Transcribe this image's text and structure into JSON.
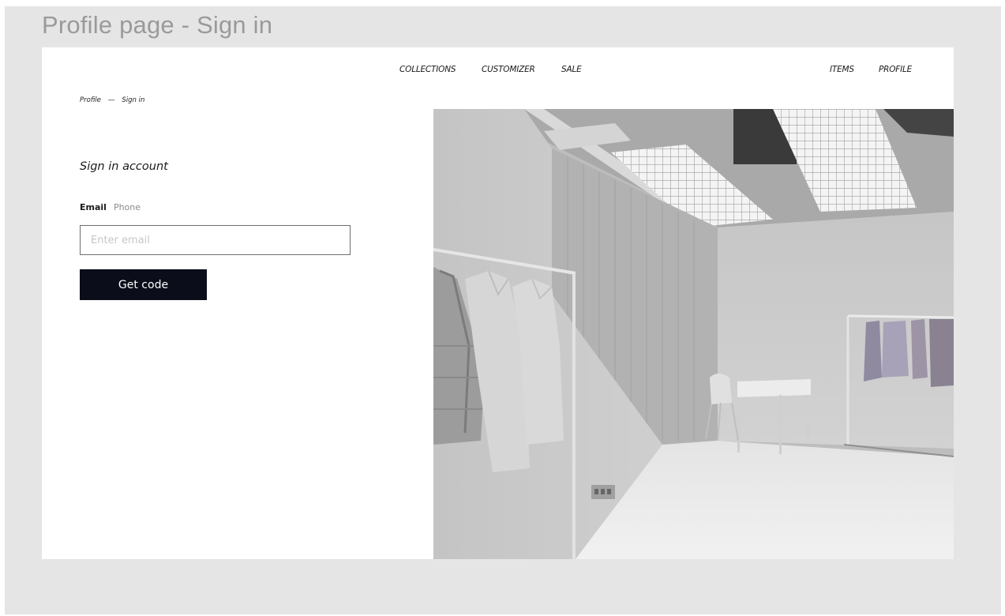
{
  "frame_title": "Profile page - Sign in",
  "nav": {
    "collections": "COLLECTIONS",
    "customizer": "CUSTOMIZER",
    "sale": "SALE",
    "items": "ITEMS",
    "profile": "PROFILE"
  },
  "breadcrumb": {
    "root": "Profile",
    "separator": "—",
    "current": "Sign in"
  },
  "form": {
    "heading": "Sign in account",
    "tabs": [
      {
        "label": "Email",
        "active": true
      },
      {
        "label": "Phone",
        "active": false
      }
    ],
    "email_value": "",
    "email_placeholder": "Enter email",
    "submit_label": "Get code"
  },
  "colors": {
    "canvas_background": "#e5e5e5",
    "button_background": "#0b0e1a",
    "button_text": "#ffffff",
    "text_primary": "#1a1a1a",
    "tab_inactive": "#8a8a8a"
  },
  "hero_image": {
    "icon": "showroom-photo"
  }
}
